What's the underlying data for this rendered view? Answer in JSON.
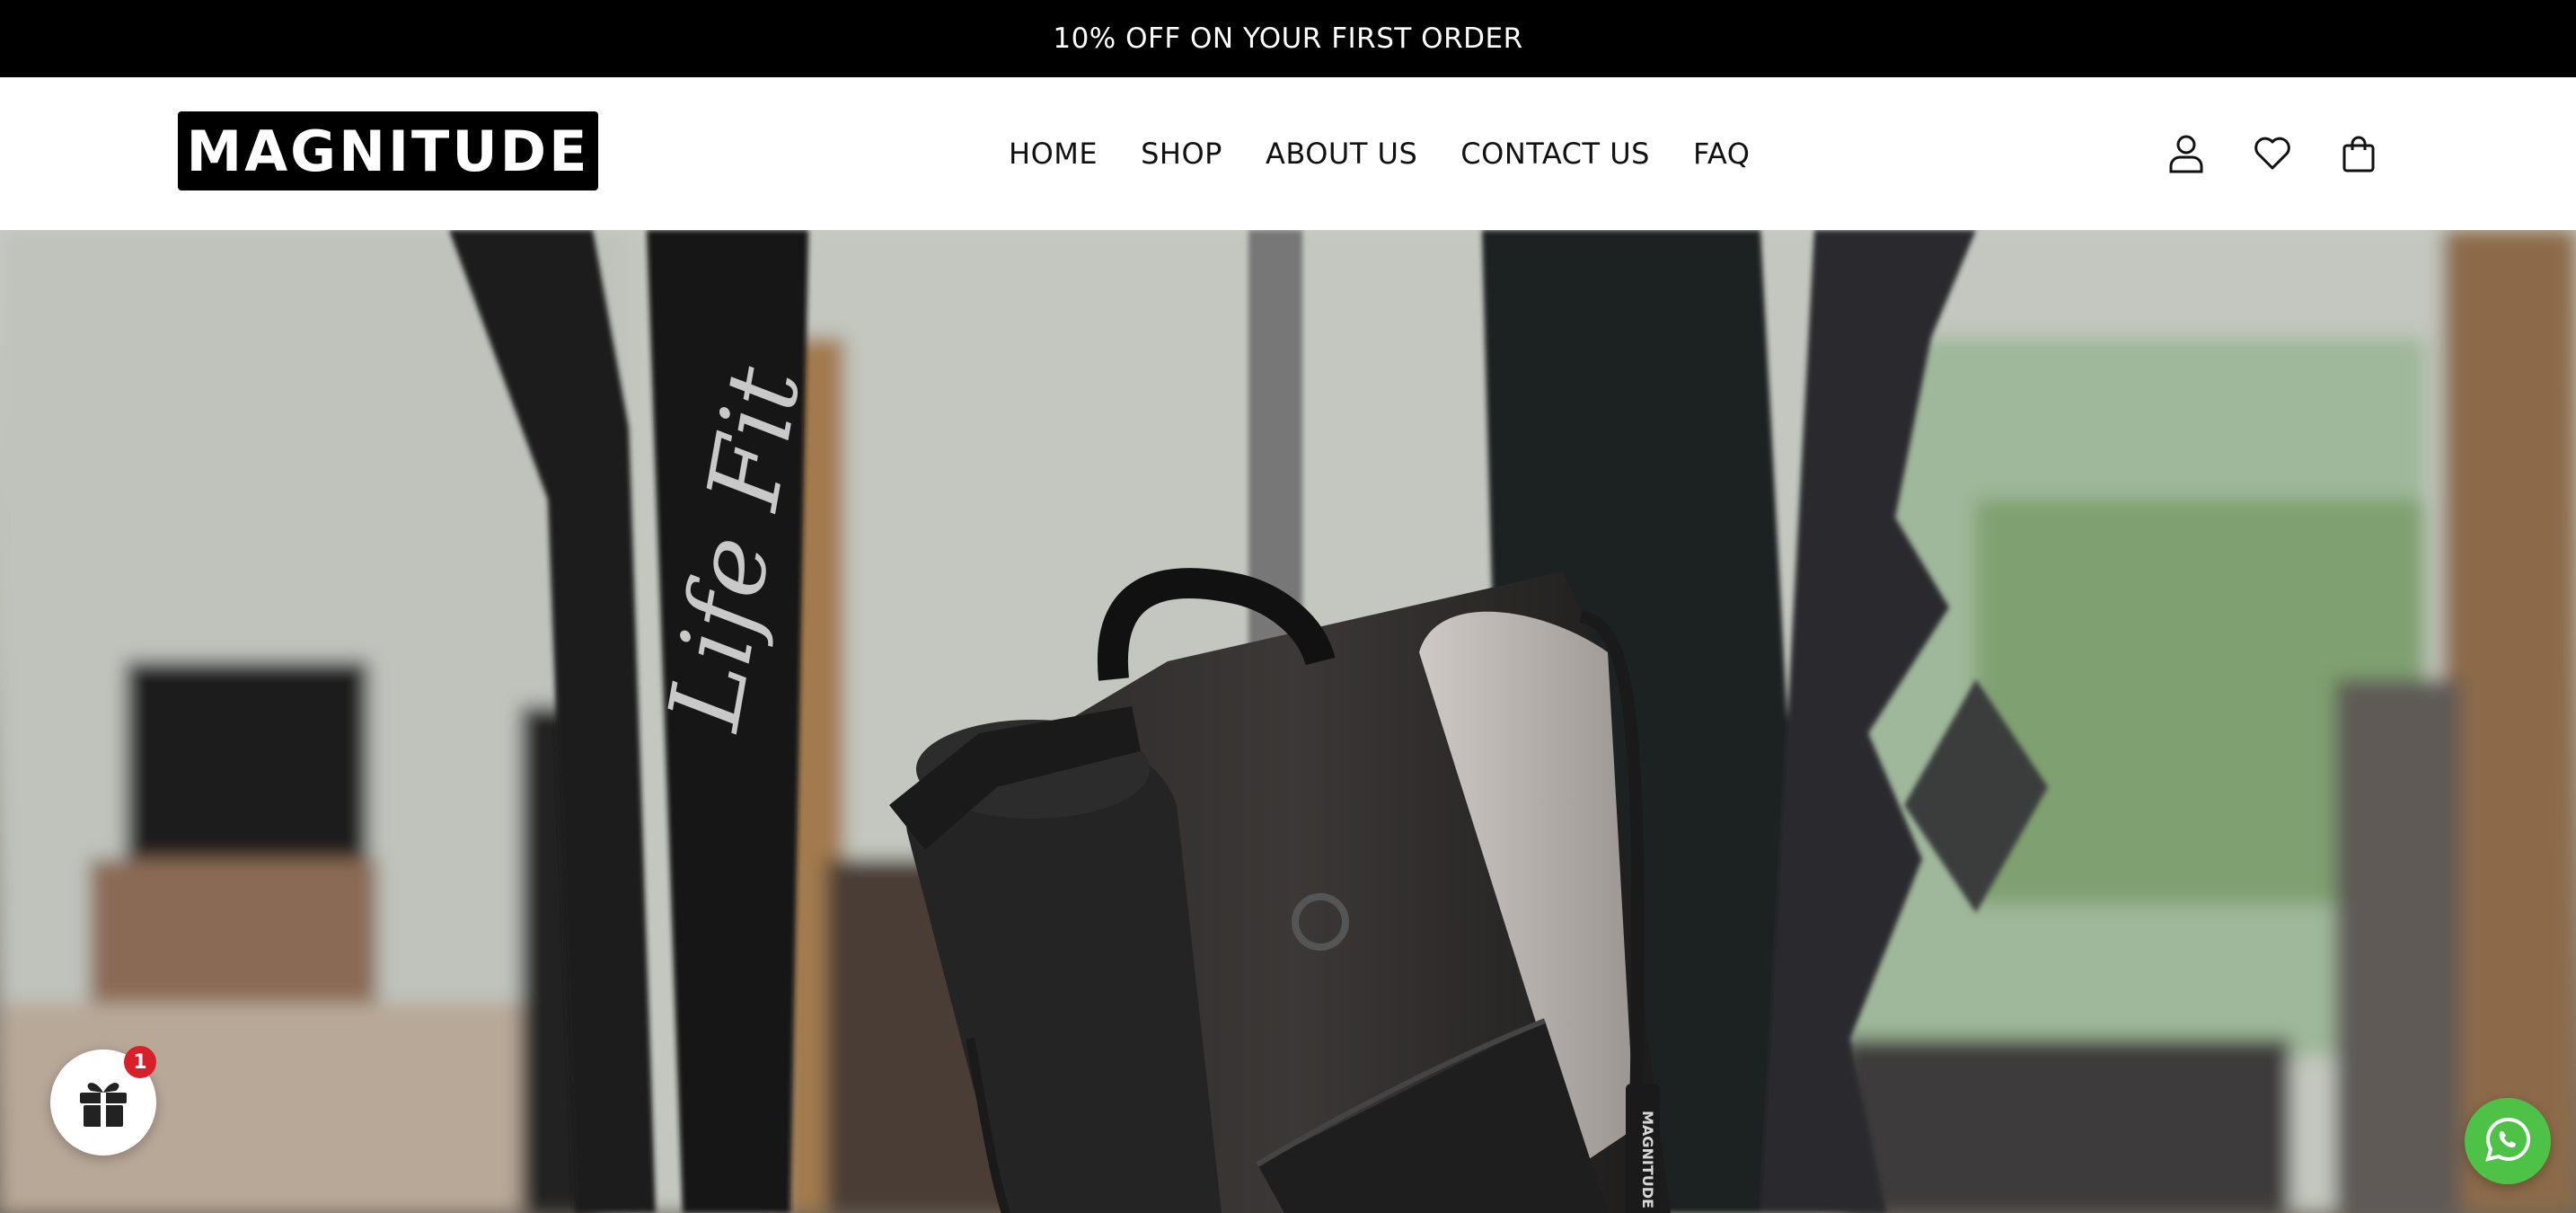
{
  "announcement": {
    "text": "10% OFF ON YOUR FIRST ORDER"
  },
  "header": {
    "logo_text": "MAGNITUDE",
    "nav": [
      {
        "label": "HOME"
      },
      {
        "label": "SHOP"
      },
      {
        "label": "ABOUT US"
      },
      {
        "label": "CONTACT US"
      },
      {
        "label": "FAQ"
      }
    ],
    "icons": [
      "account-icon",
      "wishlist-heart-icon",
      "cart-bag-icon"
    ]
  },
  "hero": {
    "image": "gym bag with bottle hanging on rack",
    "tag_text": "MAGNITUDE"
  },
  "floating": {
    "gift_badge_count": "1",
    "gift_icon": "gift-icon",
    "whatsapp_icon": "whatsapp-icon",
    "whatsapp_color": "#4dc247",
    "badge_color": "#d81f2a"
  }
}
